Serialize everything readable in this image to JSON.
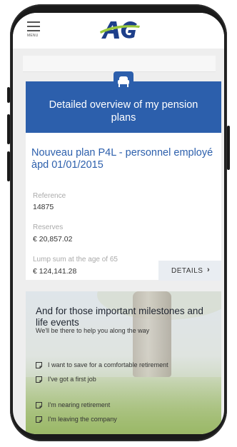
{
  "header": {
    "menu_label": "MENU",
    "logo_icon": "ag-logo"
  },
  "colors": {
    "brand_blue": "#2c5fac",
    "logo_navy": "#1e3f8a",
    "logo_green": "#9bc93b"
  },
  "overview_card": {
    "icon": "armchair-icon",
    "title": "Detailed overview of my pension plans",
    "plan_name": "Nouveau plan P4L - personnel employé àpd 01/01/2015",
    "fields": [
      {
        "label": "Reference",
        "value": "14875"
      },
      {
        "label": "Reserves",
        "value": "€ 20,857.02"
      },
      {
        "label": "Lump sum at the age of 65",
        "value": "€ 124,141.28"
      }
    ],
    "details_label": "DETAILS",
    "details_icon": "chevron-right-icon"
  },
  "milestones": {
    "title": "And for those important milestones and life events",
    "subtitle": "We'll be there to help you along the way",
    "items": [
      {
        "label": "I want to save for a comfortable retirement"
      },
      {
        "label": "I've got a first job"
      },
      {
        "label": "I'm nearing retirement"
      },
      {
        "label": "I'm leaving the company"
      }
    ]
  }
}
